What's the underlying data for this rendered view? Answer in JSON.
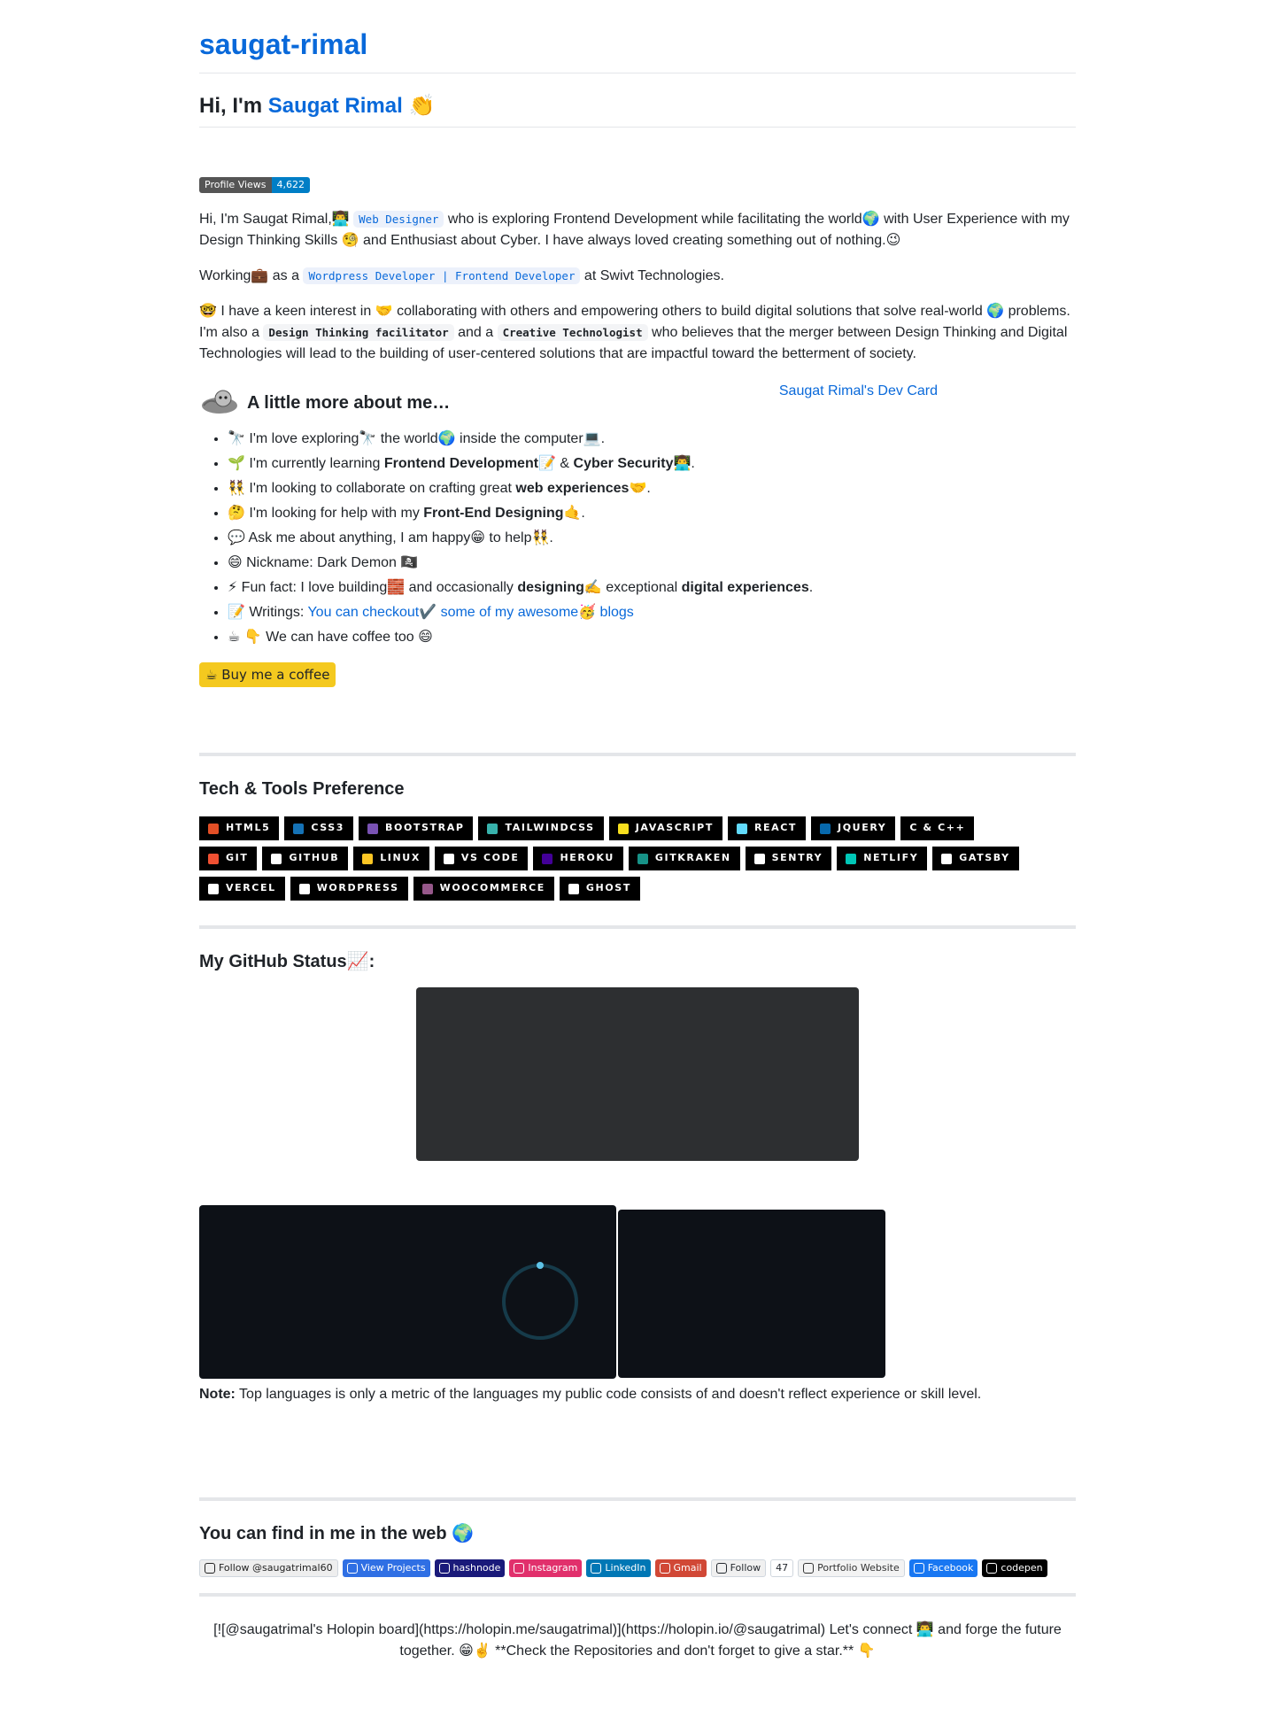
{
  "site": {
    "title": "saugat-rimal"
  },
  "intro": {
    "greeting": "Hi, I'm ",
    "name": "Saugat Rimal",
    "wave": "👏"
  },
  "views_badge": {
    "label": "Profile Views",
    "count": "4,622"
  },
  "paragraphs": {
    "p1_a": "Hi, I'm Saugat Rimal,👨‍💻 ",
    "p1_code": "Web Designer",
    "p1_b": " who is exploring Frontend Development while facilitating the world🌍 with User Experience with my Design Thinking Skills 🧐 and Enthusiast about Cyber. I have always loved creating something out of nothing.😉",
    "p2_a": "Working💼 as a ",
    "p2_code": "Wordpress Developer | Frontend Developer",
    "p2_b": " at Swivt Technologies.",
    "p3_a": "🤓 I have a keen interest in 🤝 collaborating with others and empowering others to build digital solutions that solve real-world 🌍 problems. I'm also a ",
    "p3_code1": "Design Thinking facilitator",
    "p3_b": " and a ",
    "p3_code2": "Creative Technologist",
    "p3_c": " who believes that the merger between Design Thinking and Digital Technologies will lead to the building of user-centered solutions that are impactful toward the betterment of society."
  },
  "devcard": {
    "alt": "Saugat Rimal's Dev Card"
  },
  "more": {
    "heading": "A little more about me…",
    "items": [
      {
        "a": "🔭 I'm love exploring🔭 the world🌍 inside the computer💻."
      },
      {
        "a": "🌱 I'm currently learning ",
        "b1": "Frontend Development",
        "c": "📝 & ",
        "b2": "Cyber Security",
        "d": "👨‍💻."
      },
      {
        "a": "👯 I'm looking to collaborate on crafting great ",
        "b1": "web experiences",
        "c": "🤝."
      },
      {
        "a": "🤔 I'm looking for help with my ",
        "b1": "Front-End Designing",
        "c": "🤙."
      },
      {
        "a": "💬 Ask me about anything, I am happy😁 to help👯."
      },
      {
        "a": "😄 Nickname: Dark Demon 🏴‍☠️"
      },
      {
        "a": "⚡ Fun fact: I love building🧱 and occasionally ",
        "b1": "designing",
        "c": "✍️ exceptional ",
        "b2": "digital experiences",
        "d": "."
      },
      {
        "a": "📝 Writings: ",
        "link": "You can checkout✔️ some of my awesome🥳 blogs"
      },
      {
        "a": "☕ 👇 We can have coffee too 😄"
      }
    ],
    "coffee_button": "☕ Buy me a coffee"
  },
  "tech": {
    "heading": "Tech & Tools Preference",
    "tags": [
      {
        "label": "HTML5",
        "icon": "html5-icon",
        "color": "#E34F26"
      },
      {
        "label": "CSS3",
        "icon": "css3-icon",
        "color": "#1572B6"
      },
      {
        "label": "BOOTSTRAP",
        "icon": "bootstrap-icon",
        "color": "#7952B3"
      },
      {
        "label": "TAILWINDCSS",
        "icon": "tailwind-icon",
        "color": "#38B2AC"
      },
      {
        "label": "JAVASCRIPT",
        "icon": "javascript-icon",
        "color": "#F7DF1E"
      },
      {
        "label": "REACT",
        "icon": "react-icon",
        "color": "#61DAFB"
      },
      {
        "label": "JQUERY",
        "icon": "jquery-icon",
        "color": "#0769AD"
      },
      {
        "label": "C & C++",
        "icon": "",
        "color": "#000000"
      },
      {
        "label": "GIT",
        "icon": "git-icon",
        "color": "#F05032"
      },
      {
        "label": "GITHUB",
        "icon": "github-icon",
        "color": "#ffffff"
      },
      {
        "label": "LINUX",
        "icon": "linux-icon",
        "color": "#FCC624"
      },
      {
        "label": "VS CODE",
        "icon": "vscode-icon",
        "color": "#ffffff"
      },
      {
        "label": "HEROKU",
        "icon": "heroku-icon",
        "color": "#430098"
      },
      {
        "label": "GITKRAKEN",
        "icon": "gitkraken-icon",
        "color": "#179287"
      },
      {
        "label": "SENTRY",
        "icon": "sentry-icon",
        "color": "#ffffff"
      },
      {
        "label": "NETLIFY",
        "icon": "netlify-icon",
        "color": "#00C7B7"
      },
      {
        "label": "GATSBY",
        "icon": "gatsby-icon",
        "color": "#ffffff"
      },
      {
        "label": "VERCEL",
        "icon": "vercel-icon",
        "color": "#ffffff"
      },
      {
        "label": "WORDPRESS",
        "icon": "wordpress-icon",
        "color": "#ffffff"
      },
      {
        "label": "WOOCOMMERCE",
        "icon": "woocommerce-icon",
        "color": "#96588A"
      },
      {
        "label": "GHOST",
        "icon": "ghost-icon",
        "color": "#ffffff"
      }
    ]
  },
  "github_status": {
    "heading": "My GitHub Status📈:",
    "note_label": "Note:",
    "note_text": " Top languages is only a metric of the languages my public code consists of and doesn't reflect experience or skill level."
  },
  "web": {
    "heading": "You can find in me in the web 🌍",
    "badges": [
      {
        "label": "Follow @saugatrimal60",
        "icon": "x-icon",
        "bg": "#eeeeee",
        "fg": "#222222"
      },
      {
        "label": "View Projects",
        "icon": "grid-icon",
        "bg": "#2f6fe4",
        "fg": "#ffffff"
      },
      {
        "label": "hashnode",
        "icon": "hashnode-icon",
        "bg": "#1a1a7a",
        "fg": "#ffffff"
      },
      {
        "label": "Instagram",
        "icon": "instagram-icon",
        "bg": "#e1306c",
        "fg": "#ffffff"
      },
      {
        "label": "LinkedIn",
        "icon": "linkedin-icon",
        "bg": "#0077b5",
        "fg": "#ffffff"
      },
      {
        "label": "Gmail",
        "icon": "gmail-icon",
        "bg": "#d14836",
        "fg": "#ffffff"
      },
      {
        "label": "Follow",
        "icon": "github-icon",
        "bg": "#f0f0f0",
        "fg": "#24292f"
      },
      {
        "label": "47",
        "icon": "",
        "bg": "#ffffff",
        "fg": "#24292f"
      },
      {
        "label": "Portfolio Website",
        "icon": "portfolio-icon",
        "bg": "#f3f3f3",
        "fg": "#333333"
      },
      {
        "label": "Facebook",
        "icon": "facebook-icon",
        "bg": "#1877f2",
        "fg": "#ffffff"
      },
      {
        "label": "codepen",
        "icon": "codepen-icon",
        "bg": "#000000",
        "fg": "#ffffff"
      }
    ]
  },
  "footer": {
    "text": "[![@saugatrimal's Holopin board](https://holopin.me/saugatrimal)](https://holopin.io/@saugatrimal) Let's connect 👨‍💻 and forge the future together. 😁✌️ **Check the Repositories and don't forget to give a star.** 👇"
  },
  "colors": {
    "accent": "#0969da",
    "coffee": "#f4c91f",
    "dark_card": "#2d2f31",
    "dark_panel": "#0d1117"
  }
}
